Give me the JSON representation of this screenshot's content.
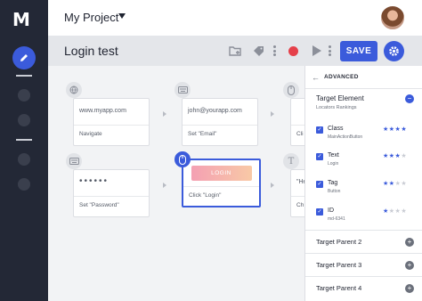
{
  "app": {
    "logo_text": "M",
    "project_name": "My Project"
  },
  "toolbar": {
    "page_title": "Login test",
    "save_label": "SAVE"
  },
  "steps": [
    {
      "value": "www.myapp.com",
      "action": "Navigate",
      "icon": "globe-icon"
    },
    {
      "value": "john@yourapp.com",
      "action": "Set \"Email\"",
      "icon": "keyboard-icon"
    },
    {
      "value": "",
      "action": "Cli",
      "icon": "mouse-icon"
    },
    {
      "value": "••••••",
      "action": "Set \"Password\"",
      "icon": "keyboard-icon"
    },
    {
      "value": "LOGIN",
      "action": "Click \"Login\"",
      "icon": "mouse-icon"
    },
    {
      "value": "\"He",
      "action": "Ch",
      "icon": "text-icon"
    }
  ],
  "panel": {
    "title": "ADVANCED",
    "target_element": {
      "title": "Target Element",
      "subtitle": "Locators Rankings"
    },
    "locators": [
      {
        "name": "Class",
        "value": "MainActionButton",
        "rating": 4
      },
      {
        "name": "Text",
        "value": "Login",
        "rating": 3
      },
      {
        "name": "Tag",
        "value": "Button",
        "rating": 2
      },
      {
        "name": "ID",
        "value": "md-6341",
        "rating": 1
      }
    ],
    "parents": [
      "Target Parent 2",
      "Target Parent 3",
      "Target Parent 4"
    ]
  },
  "colors": {
    "accent": "#3b5bdb",
    "sidebar": "#232836",
    "record": "#e5404a"
  }
}
